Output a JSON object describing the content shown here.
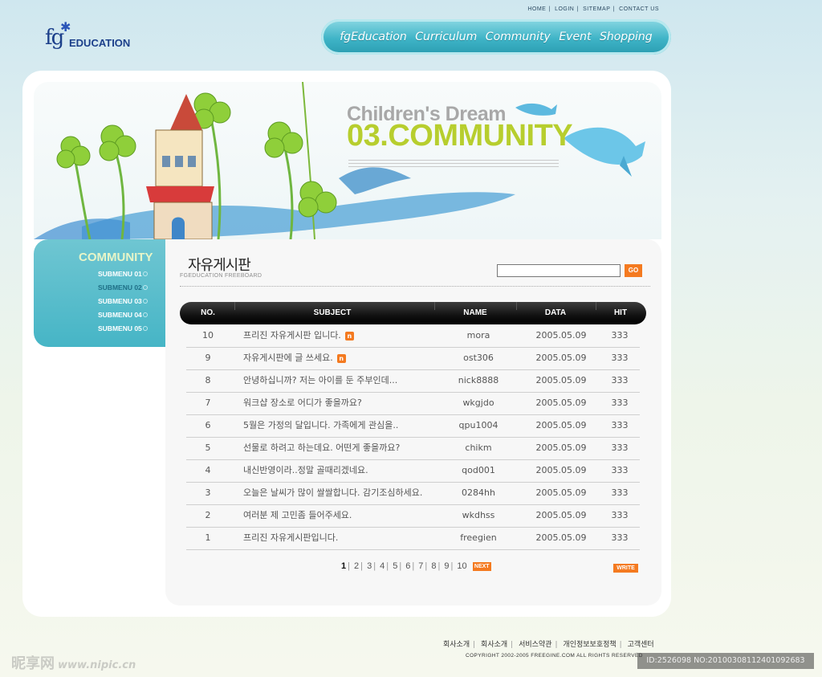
{
  "logo": {
    "fg": "fg",
    "edu": "EDUCATION"
  },
  "topnav": {
    "items": [
      "HOME",
      "LOGIN",
      "SITEMAP",
      "CONTACT US"
    ]
  },
  "gnb": {
    "items": [
      "fgEducation",
      "Curriculum",
      "Community",
      "Event",
      "Shopping"
    ]
  },
  "hero": {
    "title_line1": "Children's Dream",
    "title_line2": "03.COMMUNITY"
  },
  "snb": {
    "title": "COMMUNITY",
    "items": [
      "SUBMENU 01",
      "SUBMENU 02",
      "SUBMENU 03",
      "SUBMENU 04",
      "SUBMENU 05"
    ],
    "active_index": 1
  },
  "board": {
    "title": "자유게시판",
    "subtitle": "FGEDUCATION FREEBOARD",
    "search": {
      "value": "",
      "go_label": "GO"
    },
    "headers": {
      "no": "NO.",
      "subject": "SUBJECT",
      "name": "NAME",
      "date": "DATA",
      "hit": "HIT"
    },
    "new_badge": "n",
    "rows": [
      {
        "no": "10",
        "subject": "프리진 자유게시판 입니다.",
        "name": "mora",
        "date": "2005.05.09",
        "hit": "333",
        "is_new": true
      },
      {
        "no": "9",
        "subject": "자유게시판에 글 쓰세요.",
        "name": "ost306",
        "date": "2005.05.09",
        "hit": "333",
        "is_new": true
      },
      {
        "no": "8",
        "subject": "안녕하십니까? 저는 아이를 둔 주부인데...",
        "name": "nick8888",
        "date": "2005.05.09",
        "hit": "333",
        "is_new": false
      },
      {
        "no": "7",
        "subject": "워크샵 장소로 어디가 좋을까요?",
        "name": "wkgjdo",
        "date": "2005.05.09",
        "hit": "333",
        "is_new": false
      },
      {
        "no": "6",
        "subject": "5월은 가정의 달입니다. 가족에게 관심을..",
        "name": "qpu1004",
        "date": "2005.05.09",
        "hit": "333",
        "is_new": false
      },
      {
        "no": "5",
        "subject": "선물로 하려고 하는데요. 어떤게 좋을까요?",
        "name": "chikm",
        "date": "2005.05.09",
        "hit": "333",
        "is_new": false
      },
      {
        "no": "4",
        "subject": "내신반영이라..정말 골때리겠네요.",
        "name": "qod001",
        "date": "2005.05.09",
        "hit": "333",
        "is_new": false
      },
      {
        "no": "3",
        "subject": "오늘은 날씨가 많이 쌀쌀합니다. 감기조심하세요.",
        "name": "0284hh",
        "date": "2005.05.09",
        "hit": "333",
        "is_new": false
      },
      {
        "no": "2",
        "subject": "여러분 제 고민좀 들어주세요.",
        "name": "wkdhss",
        "date": "2005.05.09",
        "hit": "333",
        "is_new": false
      },
      {
        "no": "1",
        "subject": "프리진 자유게시판입니다.",
        "name": "freegien",
        "date": "2005.05.09",
        "hit": "333",
        "is_new": false
      }
    ],
    "pagination": {
      "pages": [
        "1",
        "2",
        "3",
        "4",
        "5",
        "6",
        "7",
        "8",
        "9",
        "10"
      ],
      "current": "1",
      "next_label": "NEXT"
    },
    "write_label": "WRITE"
  },
  "footer": {
    "links": [
      "회사소개",
      "회사소개",
      "서비스약관",
      "개인정보보호정책",
      "고객센터"
    ],
    "copyright": "COPYRIGHT 2002-2005 FREEGINE.COM ALL RIGHTS RESERVED"
  },
  "watermark": {
    "left": "昵享网",
    "left_url": "www.nipic.cn",
    "right": "ID:2526098 NO:20100308112401092683"
  },
  "colors": {
    "accent": "#f47a20",
    "nav": "#3fb4c7",
    "hero_green": "#b7ce2e"
  }
}
